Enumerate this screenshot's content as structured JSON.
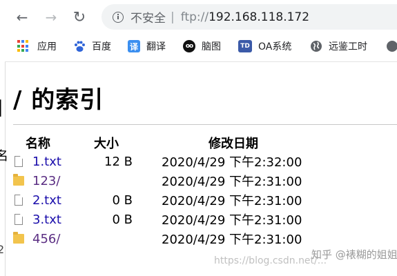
{
  "bg_window": {
    "frag1": "I",
    "frag2": "名",
    "frag3": "2"
  },
  "toolbar": {
    "back": "←",
    "forward": "→",
    "reload": "↻"
  },
  "address": {
    "security": "不安全",
    "separator": "|",
    "scheme": "ftp://",
    "host": "192.168.118.172"
  },
  "bookmarks": [
    {
      "label": "应用",
      "icon": "apps-grid-icon"
    },
    {
      "label": "百度",
      "icon": "baidu-paw-icon"
    },
    {
      "label": "翻译",
      "icon": "translate-icon",
      "glyph": "译"
    },
    {
      "label": "脑图",
      "icon": "owl-icon",
      "glyph": "oo"
    },
    {
      "label": "OA系统",
      "icon": "td-icon",
      "glyph": "TD"
    },
    {
      "label": "远鉴工时",
      "icon": "globe-icon"
    }
  ],
  "page": {
    "title": "/ 的索引",
    "headers": {
      "name": "名称",
      "size": "大小",
      "date": "修改日期"
    },
    "rows": [
      {
        "name": "1.txt",
        "type": "file",
        "size": "12 B",
        "date": "2020/4/29 下午2:32:00"
      },
      {
        "name": "123/",
        "type": "folder",
        "size": "",
        "date": "2020/4/29 下午2:31:00"
      },
      {
        "name": "2.txt",
        "type": "file",
        "size": "0 B",
        "date": "2020/4/29 下午2:31:00"
      },
      {
        "name": "3.txt",
        "type": "file",
        "size": "0 B",
        "date": "2020/4/29 下午2:31:00"
      },
      {
        "name": "456/",
        "type": "folder",
        "size": "",
        "date": "2020/4/29 下午2:31:00"
      }
    ]
  },
  "watermark": {
    "url": "https://blog.csdn.net/...",
    "author": "知乎 @裱糊的姐姐"
  },
  "colors": {
    "link": "#1a0dab",
    "visited": "#5a2d82",
    "folder": "#f2c44d"
  }
}
